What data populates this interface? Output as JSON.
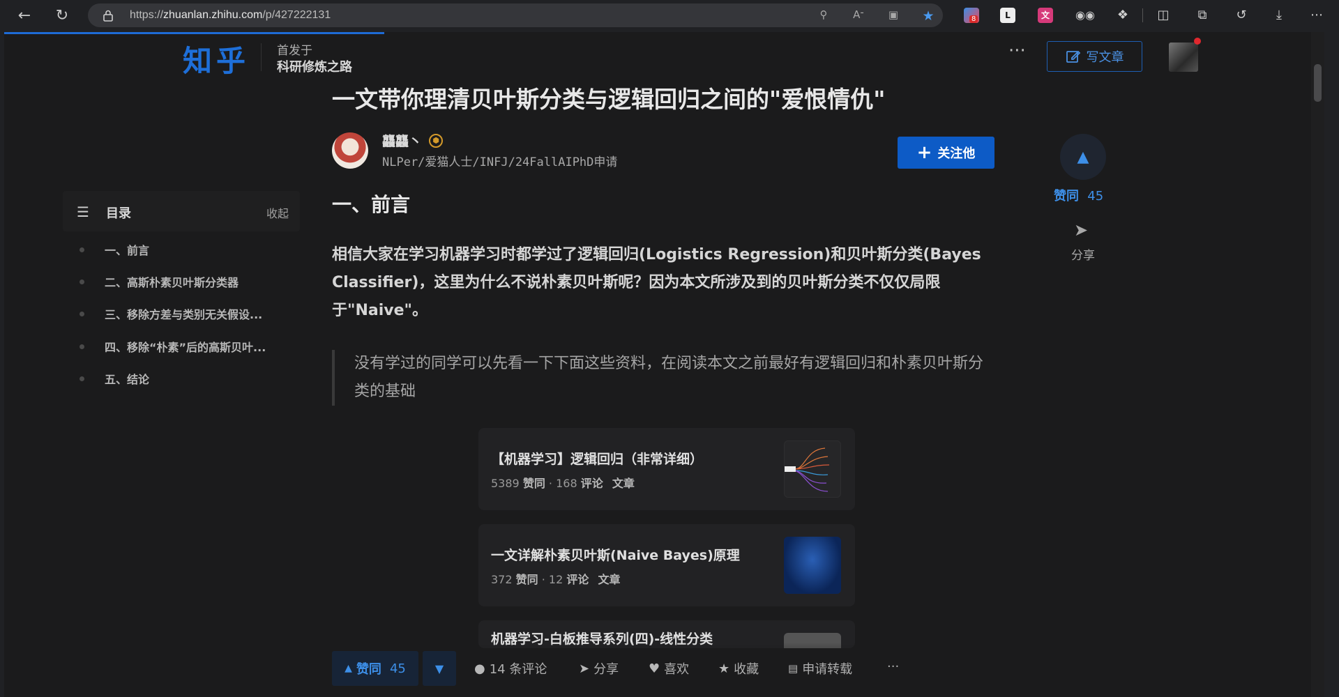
{
  "browser": {
    "url_prefix": "https://",
    "url_host": "zhuanlan.zhihu.com",
    "url_path": "/p/427222131",
    "ext_badge": "8"
  },
  "header": {
    "logo": "知乎",
    "published_in_label": "首发于",
    "column_name": "科研修炼之路",
    "write_button": "写文章",
    "more": "···"
  },
  "article": {
    "title": "一文带你理清贝叶斯分类与逻辑回归之间的\"爱恨情仇\"",
    "author_name": "龘龘丶",
    "author_bio": "NLPer/爱猫人士/INFJ/24FallAIPhD申请",
    "follow_button": "关注他",
    "section_heading": "一、前言",
    "paragraph": "相信大家在学习机器学习时都学过了逻辑回归(Logistics Regression)和贝叶斯分类(Bayes Classifier)，这里为什么不说朴素贝叶斯呢？因为本文所涉及到的贝叶斯分类不仅仅局限于\"Naive\"。",
    "quote": "没有学过的同学可以先看一下下面这些资料，在阅读本文之前最好有逻辑回归和朴素贝叶斯分类的基础"
  },
  "toc": {
    "title": "目录",
    "collapse": "收起",
    "items": [
      "一、前言",
      "二、高斯朴素贝叶斯分类器",
      "三、移除方差与类别无关假设...",
      "四、移除“朴素”后的高斯贝叶...",
      "五、结论"
    ]
  },
  "cards": [
    {
      "title": "【机器学习】逻辑回归（非常详细）",
      "likes": "5389",
      "likes_label": "赞同",
      "comments": "168",
      "comments_label": "评论",
      "type": "文章"
    },
    {
      "title": "一文详解朴素贝叶斯(Naive Bayes)原理",
      "likes": "372",
      "likes_label": "赞同",
      "comments": "12",
      "comments_label": "评论",
      "type": "文章"
    },
    {
      "title": "机器学习-白板推导系列(四)-线性分类"
    }
  ],
  "side": {
    "vote_label": "赞同",
    "vote_count": "45",
    "share_label": "分享"
  },
  "actions": {
    "vote_label": "赞同",
    "vote_count": "45",
    "comments": "14 条评论",
    "share": "分享",
    "like": "喜欢",
    "favorite": "收藏",
    "repost": "申请转载",
    "more": "···"
  },
  "icons": [
    "back-icon",
    "refresh-icon",
    "lock-icon",
    "zoom-icon",
    "read-aloud-icon",
    "immersive-reader-icon",
    "favorite-star-icon",
    "extensions-icon",
    "split-screen-icon",
    "collections-icon",
    "history-icon",
    "download-icon",
    "menu-icon",
    "edit-icon",
    "toc-icon",
    "plus-icon",
    "upvote-icon",
    "downvote-icon",
    "comment-icon",
    "share-icon",
    "heart-icon",
    "star-icon",
    "repost-icon"
  ],
  "colors": {
    "accent": "#1e6fd9",
    "vote": "#3d8fe8",
    "follow_bg": "#0d5bc6",
    "background": "#1b1b1c"
  }
}
